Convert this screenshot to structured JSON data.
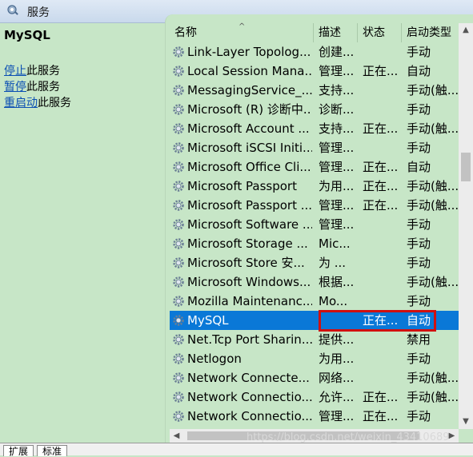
{
  "window": {
    "title": "服务",
    "icon": "services-icon"
  },
  "sidebar": {
    "service_name": "MySQL",
    "actions": [
      {
        "link": "停止",
        "rest": "此服务"
      },
      {
        "link": "暂停",
        "rest": "此服务"
      },
      {
        "link": "重启动",
        "rest": "此服务"
      }
    ]
  },
  "columns": {
    "name": "名称",
    "desc": "描述",
    "status": "状态",
    "startup": "启动类型"
  },
  "rows": [
    {
      "name": "Link-Layer Topolog...",
      "desc": "创建...",
      "status": "",
      "startup": "手动"
    },
    {
      "name": "Local Session Mana...",
      "desc": "管理...",
      "status": "正在...",
      "startup": "自动"
    },
    {
      "name": "MessagingService_...",
      "desc": "支持...",
      "status": "",
      "startup": "手动(触..."
    },
    {
      "name": "Microsoft (R) 诊断中...",
      "desc": "诊断...",
      "status": "",
      "startup": "手动"
    },
    {
      "name": "Microsoft Account ...",
      "desc": "支持...",
      "status": "正在...",
      "startup": "手动(触..."
    },
    {
      "name": "Microsoft iSCSI Initi...",
      "desc": "管理...",
      "status": "",
      "startup": "手动"
    },
    {
      "name": "Microsoft Office Cli...",
      "desc": "管理...",
      "status": "正在...",
      "startup": "自动"
    },
    {
      "name": "Microsoft Passport",
      "desc": "为用...",
      "status": "正在...",
      "startup": "手动(触..."
    },
    {
      "name": "Microsoft Passport ...",
      "desc": "管理...",
      "status": "正在...",
      "startup": "手动(触..."
    },
    {
      "name": "Microsoft Software ...",
      "desc": "管理...",
      "status": "",
      "startup": "手动"
    },
    {
      "name": "Microsoft Storage ...",
      "desc": "Mic...",
      "status": "",
      "startup": "手动"
    },
    {
      "name": "Microsoft Store 安...",
      "desc": "为 ...",
      "status": "",
      "startup": "手动"
    },
    {
      "name": "Microsoft Windows...",
      "desc": "根据...",
      "status": "",
      "startup": "手动(触..."
    },
    {
      "name": "Mozilla Maintenanc...",
      "desc": "Mo...",
      "status": "",
      "startup": "手动"
    },
    {
      "name": "MySQL",
      "desc": "",
      "status": "正在...",
      "startup": "自动",
      "selected": true
    },
    {
      "name": "Net.Tcp Port Sharin...",
      "desc": "提供...",
      "status": "",
      "startup": "禁用"
    },
    {
      "name": "Netlogon",
      "desc": "为用...",
      "status": "",
      "startup": "手动"
    },
    {
      "name": "Network Connecte...",
      "desc": "网络...",
      "status": "",
      "startup": "手动(触..."
    },
    {
      "name": "Network Connectio...",
      "desc": "允许...",
      "status": "正在...",
      "startup": "手动(触..."
    },
    {
      "name": "Network Connectio...",
      "desc": "管理...",
      "status": "正在...",
      "startup": "手动"
    }
  ],
  "bottom_tabs": [
    "扩展",
    "标准"
  ],
  "watermark": "https://blog.csdn.net/weixin_43410689",
  "colors": {
    "selection": "#0a78d7",
    "highlight_box": "#d01010",
    "background": "#c7e6c7"
  }
}
